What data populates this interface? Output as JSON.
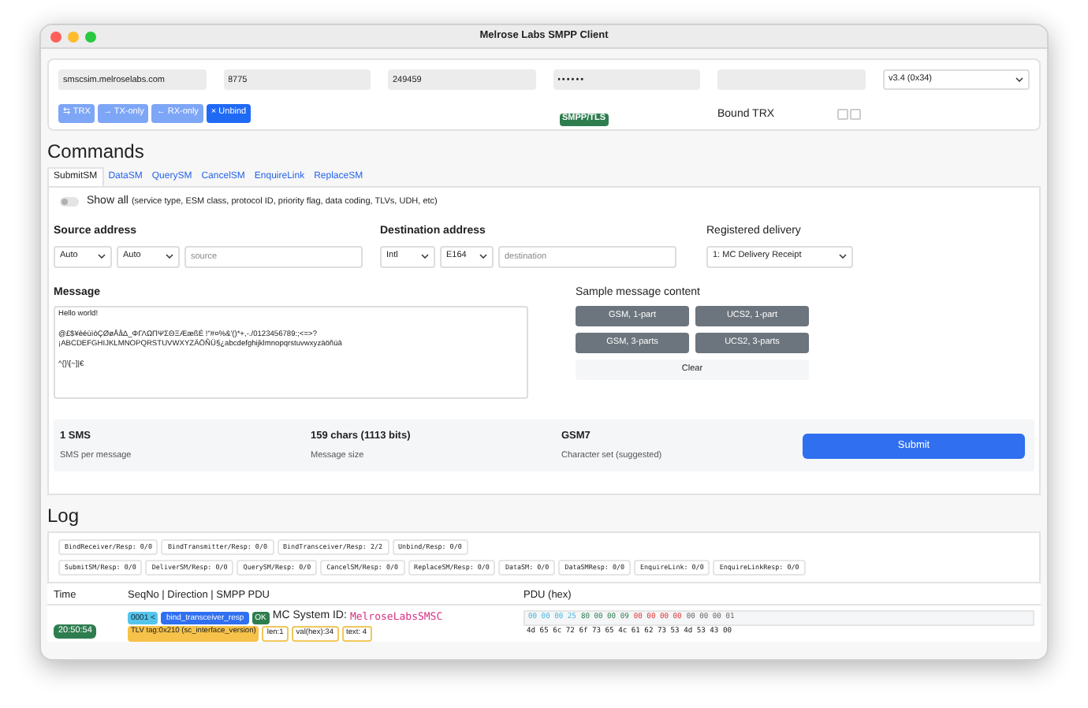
{
  "window": {
    "title": "Melrose Labs SMPP Client"
  },
  "connection": {
    "fields": [
      {
        "kind": "text",
        "value": "smscsim.melroselabs.com"
      },
      {
        "kind": "text",
        "value": "8775"
      },
      {
        "kind": "text",
        "value": "249459"
      },
      {
        "kind": "password",
        "value": "••••••"
      },
      {
        "kind": "text"
      }
    ],
    "version": "v3.4 (0x34)",
    "bind_buttons": [
      {
        "icon": "⇆",
        "label": "TRX",
        "disabled": true
      },
      {
        "icon": "→",
        "label": "TX-only",
        "disabled": true
      },
      {
        "icon": "←",
        "label": "RX-only",
        "disabled": true
      },
      {
        "icon": "×",
        "label": "Unbind",
        "disabled": false
      }
    ],
    "badge": "SMPP/TLS",
    "status": "Bound TRX"
  },
  "commands": {
    "heading": "Commands",
    "tabs": [
      {
        "label": "SubmitSM",
        "selected": true
      },
      {
        "label": "DataSM",
        "selected": false
      },
      {
        "label": "QuerySM",
        "selected": false
      },
      {
        "label": "CancelSM",
        "selected": false
      },
      {
        "label": "EnquireLink",
        "selected": false
      },
      {
        "label": "ReplaceSM",
        "selected": false
      }
    ],
    "show_all": {
      "on": false,
      "label": "Show all",
      "detail": "(service type, ESM class, protocol ID, priority flag, data coding, TLVs, UDH, etc)"
    },
    "source": {
      "label": "Source address",
      "selects": [
        "Auto",
        "Auto"
      ],
      "placeholder": "source"
    },
    "destination": {
      "label": "Destination address",
      "selects": [
        "Intl",
        "E164"
      ],
      "placeholder": "destination"
    },
    "registered_delivery": {
      "label": "Registered delivery",
      "value": "1: MC Delivery Receipt"
    },
    "message": {
      "label": "Message",
      "value": "Hello world!\n\n@£$¥èéùìòÇØøÅåΔ_ΦΓΛΩΠΨΣΘΞÆæßÉ !\"#¤%&'()*+,-./0123456789:;<=>?\n¡ABCDEFGHIJKLMNOPQRSTUVWXYZÄÖÑÜ§¿abcdefghijklmnopqrstuvwxyzäöñüà\n\n^{}\\[~]|€"
    },
    "samples": {
      "label": "Sample message content",
      "buttons": [
        {
          "kind": "sample",
          "label": "GSM, 1-part"
        },
        {
          "kind": "sample",
          "label": "UCS2, 1-part"
        },
        {
          "kind": "sample",
          "label": "GSM, 3-parts"
        },
        {
          "kind": "sample",
          "label": "UCS2, 3-parts"
        },
        {
          "kind": "clear",
          "label": "Clear"
        }
      ]
    },
    "stats": [
      {
        "value": "1 SMS",
        "label": "SMS per message"
      },
      {
        "value": "159 chars (1113 bits)",
        "label": "Message size"
      },
      {
        "value": "GSM7",
        "label": "Character set (suggested)"
      }
    ],
    "submit": "Submit"
  },
  "log": {
    "heading": "Log",
    "counters": [
      [
        "BindReceiver/Resp: 0/0",
        "BindTransmitter/Resp: 0/0",
        "BindTransceiver/Resp: 2/2",
        "Unbind/Resp: 0/0"
      ],
      [
        "SubmitSM/Resp: 0/0",
        "DeliverSM/Resp: 0/0",
        "QuerySM/Resp: 0/0",
        "CancelSM/Resp: 0/0",
        "ReplaceSM/Resp: 0/0",
        "DataSM: 0/0",
        "DataSMResp: 0/0",
        "EnquireLink: 0/0",
        "EnquireLinkResp: 0/0"
      ]
    ],
    "columns": [
      "Time",
      "SeqNo | Direction | SMPP PDU",
      "PDU (hex)"
    ],
    "rows": [
      {
        "time": "20:50:54",
        "seq": "0001 <",
        "pdu": "bind_transceiver_resp",
        "status": "OK",
        "field_label": "MC System ID:",
        "field_value": "MelroseLabsSMSC",
        "tlv": [
          {
            "kind": "tag",
            "text": "TLV tag:0x210 (sc_interface_version)"
          },
          {
            "kind": "attr",
            "text": "len:1"
          },
          {
            "kind": "attr",
            "text": "val(hex):34"
          },
          {
            "kind": "attr",
            "text": "text: 4"
          }
        ],
        "hex": [
          [
            {
              "kind": "length",
              "text": "00 00 00 25"
            },
            {
              "kind": "command",
              "text": "80 00 00 09"
            },
            {
              "kind": "status",
              "text": "00 00 00 00"
            },
            {
              "kind": "sequence",
              "text": "00 00 00 01"
            }
          ],
          [
            {
              "kind": "body",
              "text": "4d 65 6c 72 6f 73 65 4c 61 62 73 53 4d 53 43 00"
            }
          ]
        ]
      }
    ]
  }
}
